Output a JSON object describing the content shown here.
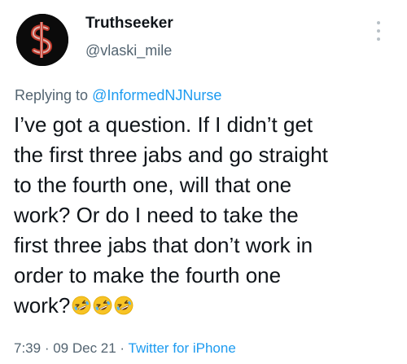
{
  "author": {
    "display_name": "Truthseeker",
    "handle": "@vlaski_mile"
  },
  "reply": {
    "prefix": "Replying to ",
    "mention": "@InformedNJNurse"
  },
  "body": {
    "lines": [
      "I’ve got a question. If I didn’t get",
      "the first three jabs and go straight",
      "to the fourth one, will that one",
      "work? Or do I need to take the",
      "first three jabs that don’t work in",
      "order to make the fourth one",
      "work?"
    ],
    "emojis": [
      "rolling-on-floor-laughing",
      "rolling-on-floor-laughing",
      "rolling-on-floor-laughing"
    ]
  },
  "meta": {
    "time": "7:39",
    "sep1": " · ",
    "date": "09 Dec 21",
    "sep2": " · ",
    "source": "Twitter for iPhone"
  },
  "colors": {
    "text": "#0f1419",
    "muted": "#536471",
    "link": "#1d9bf0",
    "avatar_bg": "#0b0b0b",
    "avatar_accent": "#c0392b"
  },
  "icons": {
    "avatar": "dollar-sign-logo",
    "more": "vertical-dots-icon",
    "emoji": "rolling-on-floor-laughing-emoji"
  }
}
